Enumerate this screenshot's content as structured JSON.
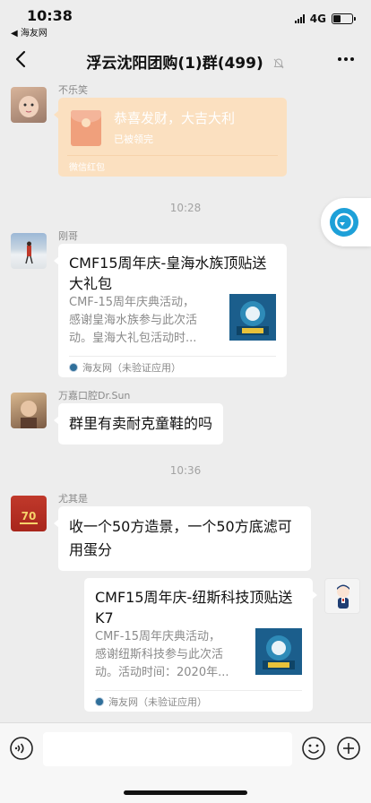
{
  "status_bar": {
    "time": "10:38",
    "back_app": "◀ 海友网",
    "network": "4G",
    "battery_level": 0.4
  },
  "nav": {
    "title": "浮云沈阳团购(1)群(499)"
  },
  "messages": {
    "m1": {
      "sender": "不乐笑",
      "red_packet": {
        "title": "恭喜发财，大吉大利",
        "status": "已被领完",
        "footer": "微信红包"
      }
    },
    "t1": "10:28",
    "m2": {
      "sender": "刚哥",
      "card": {
        "title": "CMF15周年庆-皇海水族顶贴送大礼包",
        "desc": [
          "CMF-15周年庆典活动，",
          "感谢皇海水族参与此次活",
          "动。皇海大礼包活动时..."
        ],
        "source": "海友网（未验证应用）"
      }
    },
    "m3": {
      "sender": "万嘉口腔Dr.Sun",
      "text": "群里有卖耐克童鞋的吗"
    },
    "t2": "10:36",
    "m4": {
      "sender": "尤其是",
      "text": "收一个50方造景，一个50方底滤可用蛋分"
    },
    "m5": {
      "card": {
        "title": "CMF15周年庆-纽斯科技顶贴送K7",
        "desc": [
          "CMF-15周年庆典活动，",
          "感谢纽斯科技参与此次活",
          "动。活动时间：2020年..."
        ],
        "source": "海友网（未验证应用）"
      }
    }
  },
  "icons": {
    "back": "chevron-left-icon",
    "mute": "bell-off-icon",
    "more": "more-dots-icon",
    "voice": "voice-icon",
    "emoji": "emoji-icon",
    "plus": "plus-icon"
  }
}
